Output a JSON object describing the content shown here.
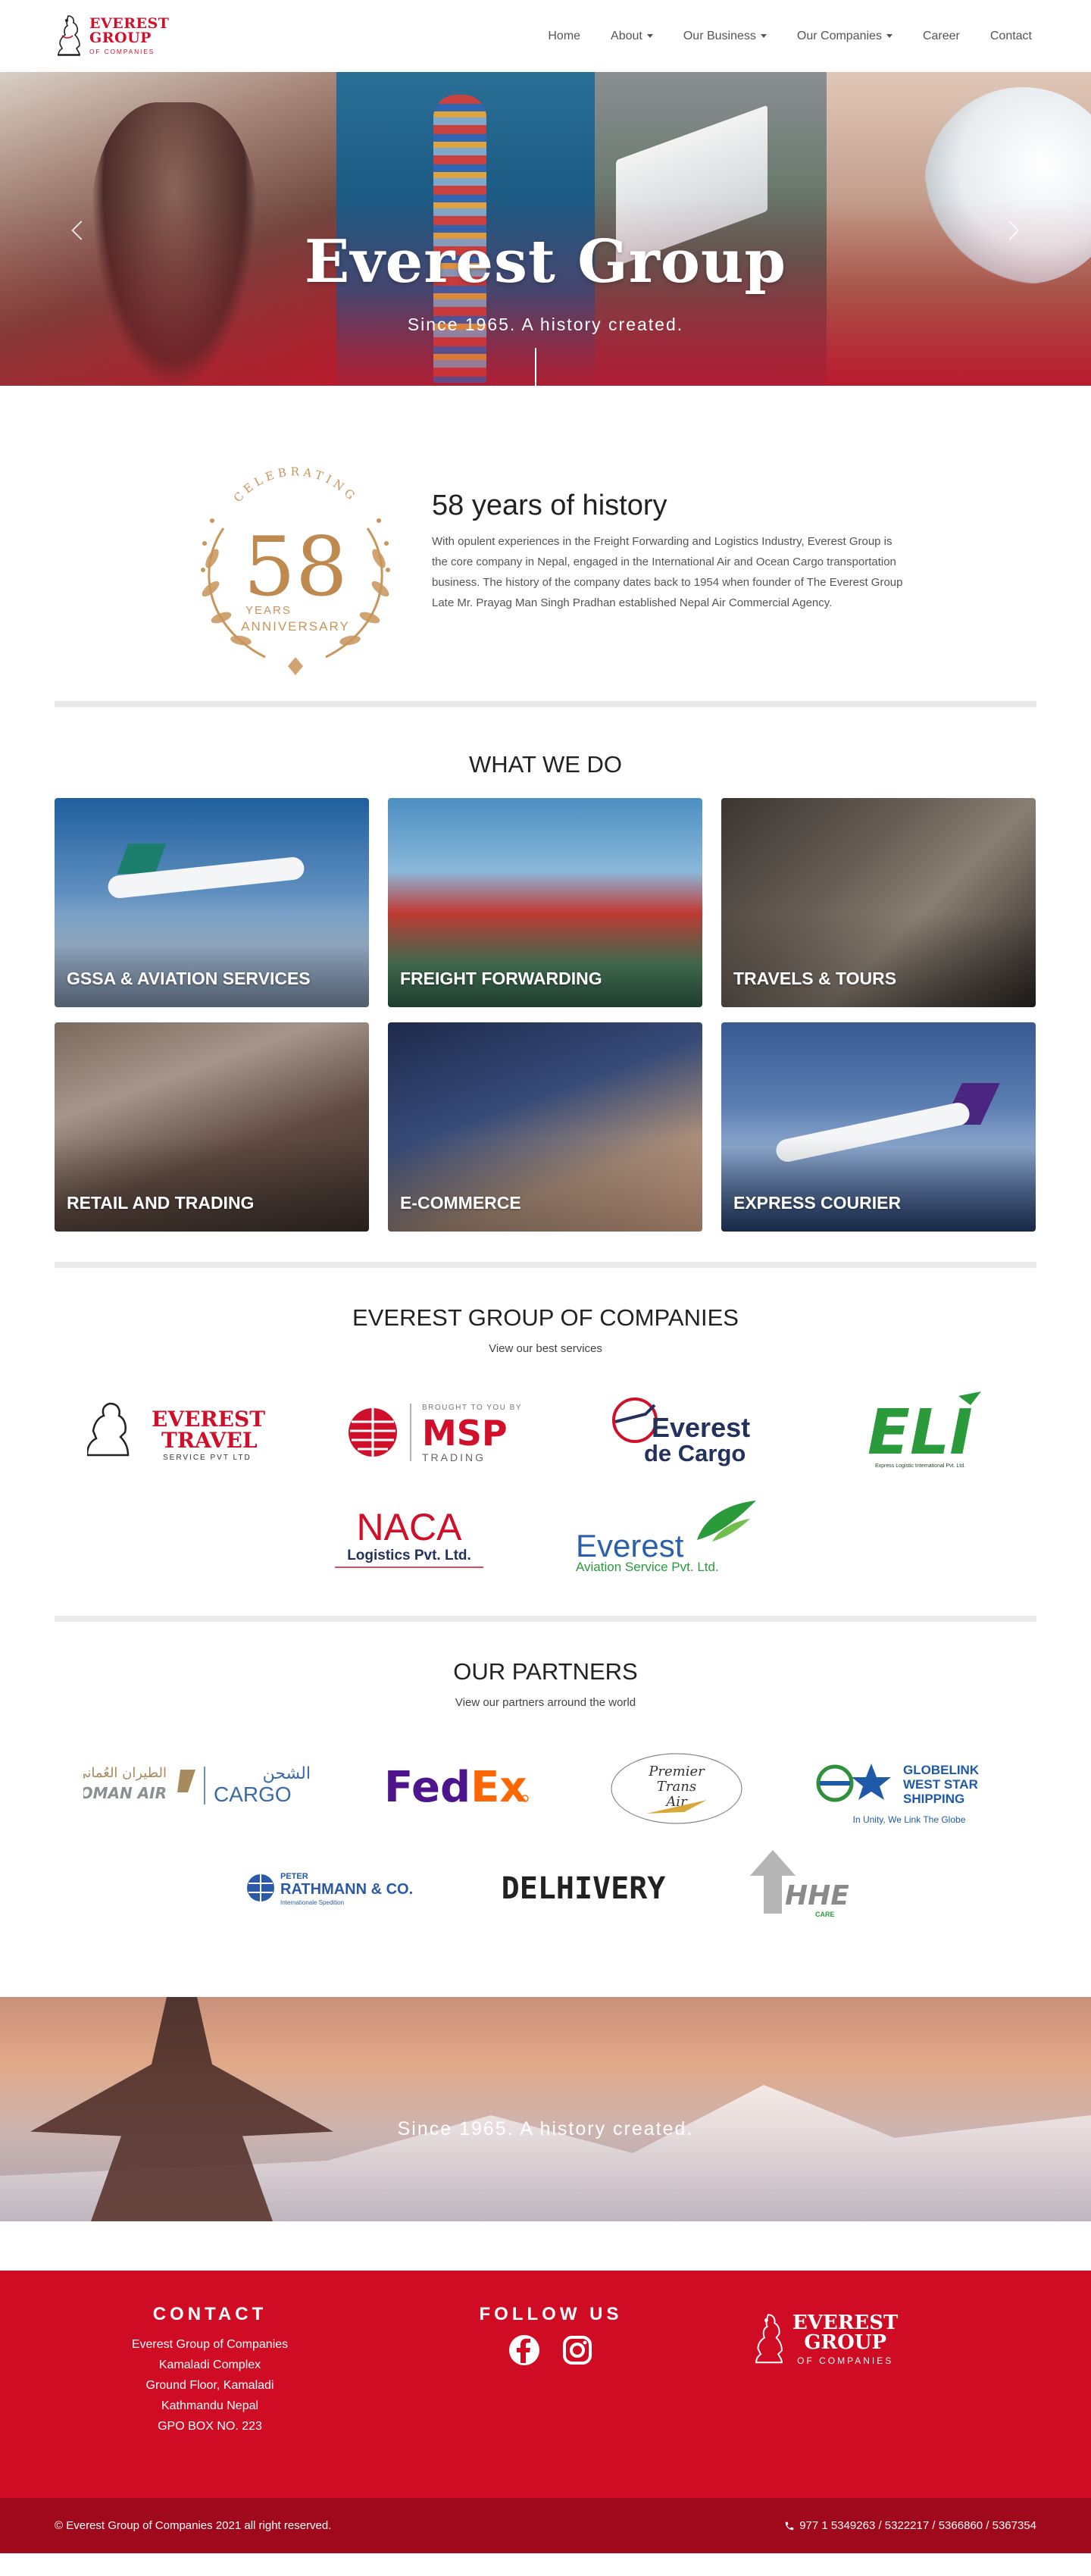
{
  "nav": {
    "logo": {
      "line1": "EVEREST",
      "line2": "GROUP",
      "line3": "OF COMPANIES"
    },
    "items": [
      {
        "label": "Home",
        "dropdown": false
      },
      {
        "label": "About",
        "dropdown": true
      },
      {
        "label": "Our Business",
        "dropdown": true
      },
      {
        "label": "Our Companies",
        "dropdown": true
      },
      {
        "label": "Career",
        "dropdown": false
      },
      {
        "label": "Contact",
        "dropdown": false
      }
    ]
  },
  "hero": {
    "title": "Everest Group",
    "subtitle": "Since 1965. A history created."
  },
  "history": {
    "badge": {
      "arc": "CELEBRATING",
      "number": "58",
      "years": "YEARS",
      "anniversary": "ANNIVERSARY"
    },
    "title": "58 years of history",
    "body": "With opulent experiences in the Freight Forwarding and Logistics Industry, Everest Group is the core company in Nepal, engaged in the International Air and Ocean Cargo transportation business. The history of the company dates back to 1954 when founder of The Everest Group Late Mr. Prayag Man Singh Pradhan established Nepal Air Commercial Agency."
  },
  "what_we_do": {
    "title": "WHAT WE DO",
    "cards": [
      {
        "label": "GSSA & AVIATION SERVICES"
      },
      {
        "label": "FREIGHT FORWARDING"
      },
      {
        "label": "TRAVELS & TOURS"
      },
      {
        "label": "RETAIL AND TRADING"
      },
      {
        "label": "E-COMMERCE"
      },
      {
        "label": "EXPRESS COURIER"
      }
    ]
  },
  "companies": {
    "title": "EVEREST GROUP OF COMPANIES",
    "subtitle": "View our best services",
    "logos": {
      "travel": {
        "l1": "EVEREST",
        "l2": "TRAVEL",
        "l3": "SERVICE PVT LTD"
      },
      "msp": {
        "small": "BROUGHT TO YOU BY",
        "big": "MSP",
        "sub": "TRADING"
      },
      "cargo": {
        "l1": "Everest",
        "l2": "de Cargo"
      },
      "eli": {
        "big": "ELI",
        "sub": "Express Logistic International Pvt. Ltd."
      },
      "naca": {
        "big": "NACA",
        "sub": "Logistics Pvt. Ltd."
      },
      "aviation": {
        "big": "Everest",
        "sub": "Aviation Service Pvt. Ltd."
      }
    }
  },
  "partners": {
    "title": "OUR PARTNERS",
    "subtitle": "View our partners arround the world",
    "logos": {
      "oman": {
        "arabic1": "الطيران العُماني",
        "arabic2": "الشحن",
        "en1": "OMAN AIR",
        "en2": "CARGO"
      },
      "fedex": {
        "fed": "Fed",
        "ex": "Ex"
      },
      "premier": {
        "l1": "Premier",
        "l2": "Trans",
        "l3": "Air"
      },
      "globelink": {
        "l1": "GLOBELINK",
        "l2": "WEST STAR",
        "l3": "SHIPPING",
        "tag": "In Unity, We Link The Globe"
      },
      "rathmann": {
        "small": "PETER",
        "big": "RATHMANN & CO.",
        "sub": "Internationale Spedition"
      },
      "delhivery": {
        "text": "DELHIVERY"
      },
      "hhe": {
        "text": "HHE",
        "sub": "CARE"
      }
    }
  },
  "banner": {
    "text": "Since 1965. A history created."
  },
  "footer": {
    "contact": {
      "title": "CONTACT",
      "lines": [
        "Everest Group of Companies",
        "Kamaladi Complex",
        "Ground Floor, Kamaladi",
        "Kathmandu Nepal",
        "GPO BOX NO. 223"
      ]
    },
    "follow": {
      "title": "FOLLOW US",
      "icons": [
        "facebook-icon",
        "instagram-icon"
      ]
    },
    "logo": {
      "line1": "EVEREST",
      "line2": "GROUP",
      "line3": "OF COMPANIES"
    },
    "copyright": "© Everest Group of Companies 2021 all right reserved.",
    "phone": "977 1 5349263 / 5322217 / 5366860 / 5367354"
  },
  "colors": {
    "brand_red": "#cf0c24",
    "footer_dark": "#a0091c",
    "gold": "#c8955a"
  }
}
